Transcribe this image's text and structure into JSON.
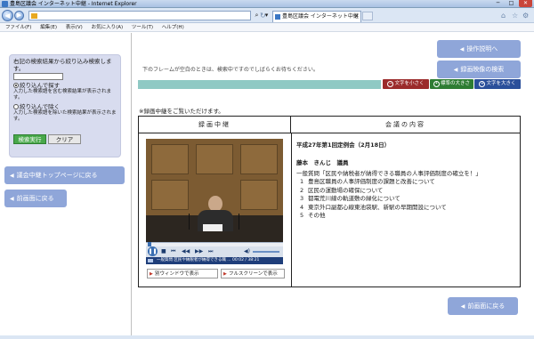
{
  "window": {
    "title": "豊島区議会 インターネット中継 - Internet Explorer",
    "minimize": "─",
    "maximize": "□",
    "close": "✕"
  },
  "browser": {
    "tab_title": "豊島区議会 インターネット中継",
    "address_dropdown": "▾",
    "search_glyph": "⌕",
    "refresh_glyph": "↻",
    "home_glyph": "⌂",
    "star_glyph": "☆",
    "gear_glyph": "⚙"
  },
  "menu": [
    "ファイル(F)",
    "編集(E)",
    "表示(V)",
    "お気に入り(A)",
    "ツール(T)",
    "ヘルプ(H)"
  ],
  "filter": {
    "heading": "右記の検索結果から絞り込み検索します。",
    "keyword_value": "",
    "option1_label": "絞り込んで探す",
    "option1_desc": "入力した検索語を含む検索結果が表示されます。",
    "option2_label": "絞り込んで除く",
    "option2_desc": "入力した検索語を除いた検索結果が表示されます。",
    "search_button": "検索実行",
    "clear_button": "クリア"
  },
  "left_nav": {
    "top_page": "議会中継トップページに戻る",
    "back": "前画面に戻る"
  },
  "right_nav": {
    "manual": "操作説明へ",
    "video_search": "録画映像の検索",
    "back_bottom": "前画面に戻る"
  },
  "notice": "下のフレームが空白のときは、検索中ですのでしばらくお待ちください。",
  "text_size": {
    "small": "文字を小さく",
    "standard": "標準の大きさ",
    "large": "文字を大きく"
  },
  "watching": "※録画中継をご覧いただけます。",
  "table": {
    "left_header": "録画中継",
    "right_header": "会議の内容"
  },
  "player": {
    "status": "一般質問 区民や納税者が納得できる職 ... 00:02 / 38:21",
    "separate_window": "別ウィンドウで表示",
    "fullscreen": "フルスクリーンで表示"
  },
  "meeting": {
    "session": "平成27年第1回定例会（2月18日）",
    "speaker": "藤本　きんじ　議員",
    "question_title": "一般質問「区民や納税者が納得できる職員の人事評価制度の確立を！」",
    "items": [
      {
        "num": "1",
        "text": "豊島区職員の人事評価制度の課題と改善について"
      },
      {
        "num": "2",
        "text": "区民の運動場の確保について"
      },
      {
        "num": "3",
        "text": "都電荒川線の軌道敷の緑化について"
      },
      {
        "num": "4",
        "text": "東京外口副都心線東池袋駅、新駅の早期開設について"
      },
      {
        "num": "5",
        "text": "その他"
      }
    ]
  }
}
